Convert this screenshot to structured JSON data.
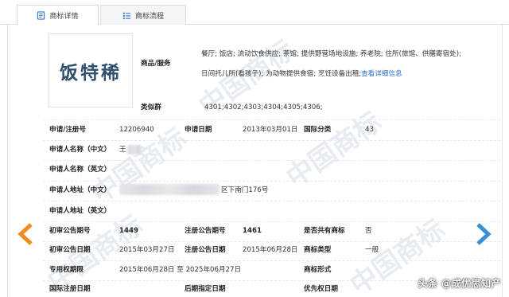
{
  "tabs": [
    {
      "label": "商标详情",
      "active": true,
      "icon": "document-icon"
    },
    {
      "label": "商标流程",
      "active": false,
      "icon": "list-icon"
    }
  ],
  "logo": {
    "text": "饭特稀"
  },
  "watermark_text": "中国商标",
  "goods": {
    "label": "商品/服务",
    "line1": "餐厅; 饭店; 流动饮食供应; 茶馆; 提供野营场地设施; 养老院; 住所(旅馆、供膳寄宿处);",
    "line2": "日间托儿所(看孩子); 为动物提供食宿; 烹饪设备出租;",
    "more_link": "查看详细信息"
  },
  "similar_group": {
    "label": "类似群",
    "value": "4301;4302;4303;4304;4305;4306;"
  },
  "fields": {
    "reg_no_label": "申请/注册号",
    "reg_no": "12206940",
    "apply_date_label": "申请日期",
    "apply_date": "2013年03月01日",
    "intl_class_label": "国际分类",
    "intl_class": "43",
    "applicant_cn_label": "申请人名称（中文）",
    "applicant_cn": "王",
    "applicant_en_label": "申请人名称（英文）",
    "address_cn_label": "申请人地址（中文）",
    "address_cn": "区下南门176号",
    "address_en_label": "申请人地址（英文）",
    "prelim_no_label": "初审公告期号",
    "prelim_no": "1449",
    "reg_notice_no_label": "注册公告期号",
    "reg_notice_no": "1461",
    "shared_label": "是否共有商标",
    "shared": "否",
    "prelim_date_label": "初审公告日期",
    "prelim_date": "2015年03月27日",
    "reg_notice_date_label": "注册公告日期",
    "reg_notice_date": "2015年06月28日",
    "tm_type_label": "商标类型",
    "tm_type": "一般",
    "exclusive_label": "专用权期限",
    "exclusive": "2015年06月28日 至 2025年06月27日",
    "tm_form_label": "商标形式",
    "intl_reg_date_label": "国际注册日期",
    "later_date_label": "后期指定日期",
    "priority_label": "优先权日期"
  },
  "nav": {
    "prev": "previous-arrow",
    "next": "next-arrow",
    "prev_color": "#f08a1c",
    "next_color": "#3a8fd6"
  },
  "footer": {
    "brand": "头条 @成优思知产"
  }
}
